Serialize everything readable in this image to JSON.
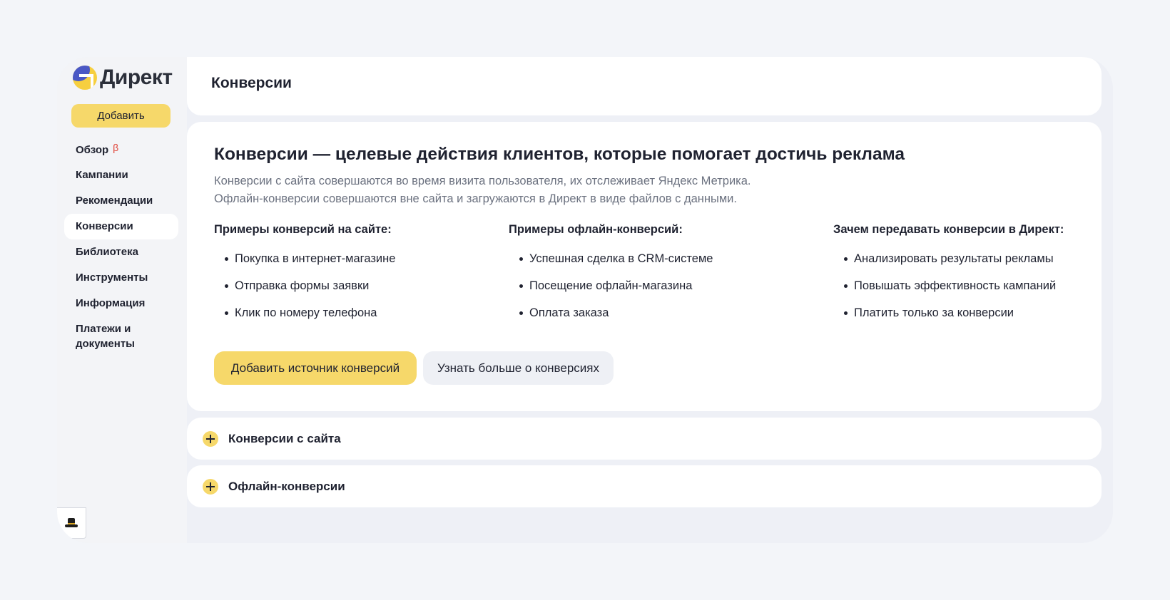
{
  "app": {
    "logo_text": "Директ"
  },
  "sidebar": {
    "add_label": "Добавить",
    "items": [
      {
        "label": "Обзор",
        "badge": "β"
      },
      {
        "label": "Кампании"
      },
      {
        "label": "Рекомендации"
      },
      {
        "label": "Конверсии",
        "active": true
      },
      {
        "label": "Библиотека"
      },
      {
        "label": "Инструменты"
      },
      {
        "label": "Информация"
      },
      {
        "label_line1": "Платежи и",
        "label_line2": "документы"
      }
    ]
  },
  "header": {
    "title": "Конверсии"
  },
  "intro": {
    "title": "Конверсии — целевые действия клиентов, которые помогает достичь реклама",
    "text_line1": "Конверсии с сайта совершаются во время визита пользователя, их отслеживает Яндекс Метрика.",
    "text_line2": "Офлайн-конверсии совершаются вне сайта и загружаются в Директ в виде файлов с данными.",
    "columns": [
      {
        "title": "Примеры конверсий на сайте:",
        "items": [
          "Покупка в интернет-магазине",
          "Отправка формы заявки",
          "Клик по номеру телефона"
        ]
      },
      {
        "title": "Примеры офлайн-конверсий:",
        "items": [
          "Успешная сделка в CRM-системе",
          "Посещение офлайн-магазина",
          "Оплата заказа"
        ]
      },
      {
        "title": "Зачем передавать конверсии в Директ:",
        "items": [
          "Анализировать результаты рекламы",
          "Повышать эффективность кампаний",
          "Платить только за конверсии"
        ]
      }
    ],
    "primary_button": "Добавить источник конверсий",
    "secondary_button": "Узнать больше о конверсиях"
  },
  "accordions": [
    {
      "label": "Конверсии с сайта",
      "icon": "plus-icon"
    },
    {
      "label": "Офлайн-конверсии",
      "icon": "plus-icon"
    }
  ],
  "colors": {
    "accent": "#f6d86a",
    "brand_blue": "#4a58c5",
    "background": "#f3f5f9"
  }
}
